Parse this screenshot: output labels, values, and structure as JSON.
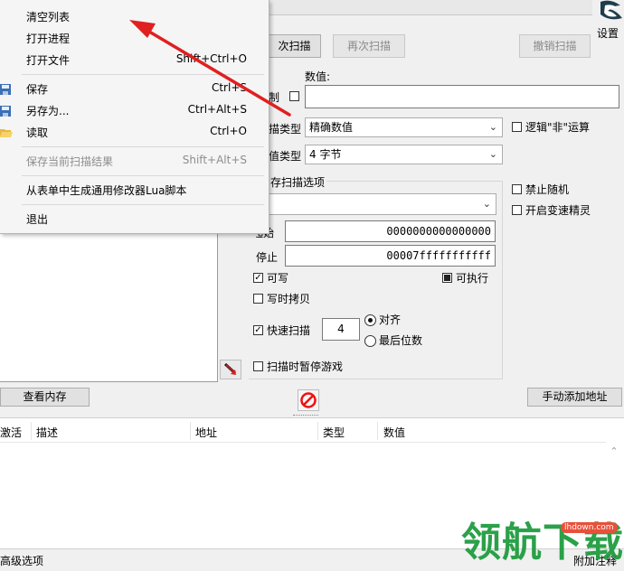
{
  "menu": {
    "items": [
      {
        "label": "清空列表",
        "shortcut": ""
      },
      {
        "label": "打开进程",
        "shortcut": ""
      },
      {
        "label": "打开文件",
        "shortcut": "Shift+Ctrl+O"
      },
      {
        "label": "保存",
        "shortcut": "Ctrl+S"
      },
      {
        "label": "另存为...",
        "shortcut": "Ctrl+Alt+S"
      },
      {
        "label": "读取",
        "shortcut": "Ctrl+O"
      },
      {
        "label": "保存当前扫描结果",
        "shortcut": "Shift+Alt+S"
      },
      {
        "label": "从表单中生成通用修改器Lua脚本",
        "shortcut": ""
      },
      {
        "label": "退出",
        "shortcut": ""
      }
    ]
  },
  "toolbar": {
    "first_scan_fragment": "次扫描",
    "next_scan": "再次扫描",
    "undo_scan": "撤销扫描",
    "settings": "设置"
  },
  "scan": {
    "value_label": "数值:",
    "hex_fragment": "制",
    "scan_type_label_fragment": "描类型",
    "scan_type_value": "精确数值",
    "value_type_label_fragment": "值类型",
    "value_type_value": "4 字节",
    "logic_not": "逻辑\"非\"运算",
    "memory_options_fragment": "存扫描选项",
    "region_value_fragment": "l",
    "start_label_fragment": "起始",
    "start_value": "0000000000000000",
    "stop_label": "停止",
    "stop_value": "00007fffffffffff",
    "writable": "可写",
    "executable": "可执行",
    "copy_on_write": "写时拷贝",
    "fast_scan": "快速扫描",
    "fast_scan_value": "4",
    "align": "对齐",
    "last_digits": "最后位数",
    "pause_game": "扫描时暂停游戏",
    "disable_random": "禁止随机",
    "speedhack": "开启变速精灵"
  },
  "bottom": {
    "view_memory": "查看内存",
    "add_address_manually": "手动添加地址",
    "advanced_options": "高级选项",
    "add_comment_fragment": "附加注释"
  },
  "table": {
    "columns": [
      "激活",
      "描述",
      "地址",
      "类型",
      "数值"
    ]
  },
  "watermark": {
    "text": "领航下载",
    "site": "lhdown.com"
  },
  "colors": {
    "arrow": "#e02020",
    "watermark_green": "#1a9a3a",
    "watermark_badge": "#e8503a"
  }
}
